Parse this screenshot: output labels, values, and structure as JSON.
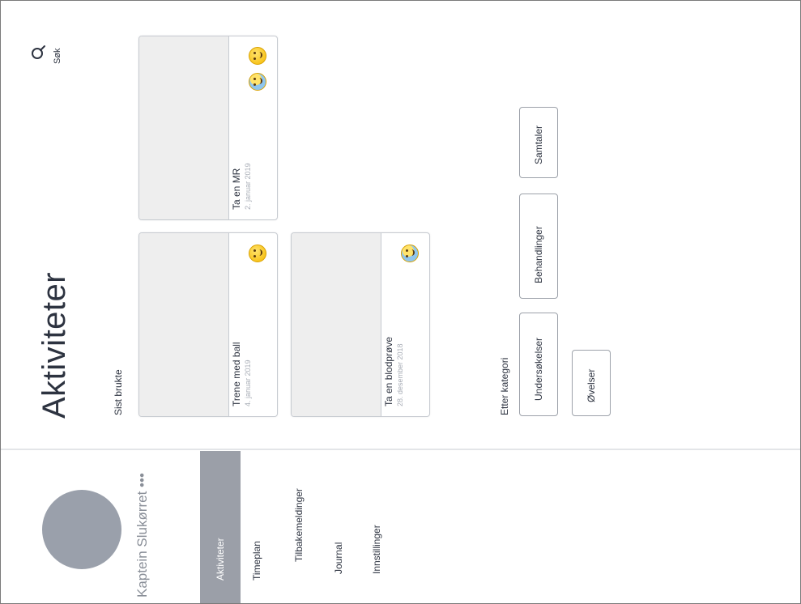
{
  "profile": {
    "name": "Kaptein Slukørret •••"
  },
  "nav": {
    "items": [
      {
        "label": "Aktiviteter",
        "active": true
      },
      {
        "label": "Timeplan",
        "active": false
      },
      {
        "label": "Tilbakemeldinger",
        "active": false
      },
      {
        "label": "Journal",
        "active": false
      },
      {
        "label": "Innstillinger",
        "active": false
      }
    ]
  },
  "header": {
    "title": "Aktiviteter",
    "search_label": "Søk",
    "search_icon": "search-icon"
  },
  "recent": {
    "label": "Sist brukte",
    "cards": [
      {
        "title": "Trene med ball",
        "date": "4. januar 2019",
        "emojis": [
          "smiling-face-icon"
        ]
      },
      {
        "title": "Ta en MR",
        "date": "2. januar 2019",
        "emojis": [
          "crying-face-icon",
          "sad-face-icon"
        ]
      },
      {
        "title": "Ta en blodprøve",
        "date": "28. desember 2018",
        "emojis": [
          "sad-face-icon"
        ]
      }
    ]
  },
  "categories": {
    "label": "Etter kategori",
    "buttons": [
      "Undersøkelser",
      "Behandlinger",
      "Samtaler",
      "Øvelser"
    ]
  },
  "colors": {
    "accent": "#9b9fa8",
    "text": "#2d3340",
    "muted": "#a8adb6",
    "emoji": "#f5b800"
  }
}
